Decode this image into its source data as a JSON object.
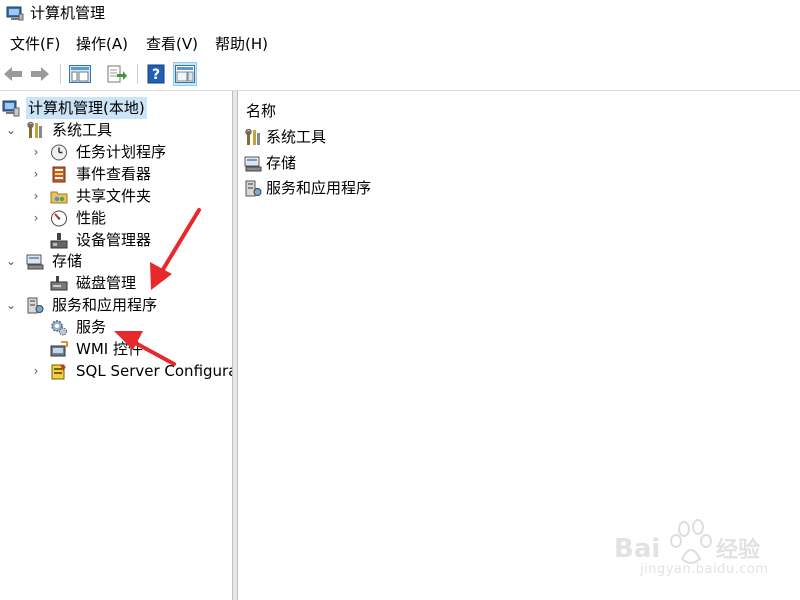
{
  "window": {
    "title": "计算机管理"
  },
  "menu": [
    {
      "label": "文件(F)"
    },
    {
      "label": "操作(A)"
    },
    {
      "label": "查看(V)"
    },
    {
      "label": "帮助(H)"
    }
  ],
  "toolbar": {
    "buttons": [
      {
        "name": "back-arrow-icon"
      },
      {
        "name": "forward-arrow-icon"
      },
      {
        "name": "show-console-tree-icon"
      },
      {
        "name": "export-list-icon"
      },
      {
        "name": "help-icon"
      },
      {
        "name": "show-action-pane-icon"
      }
    ]
  },
  "tree": {
    "root": {
      "label": "计算机管理(本地)",
      "icon": "computer-management-icon",
      "selected": true
    },
    "items": [
      {
        "label": "系统工具",
        "icon": "tools-icon",
        "level": 1,
        "expander": "expanded"
      },
      {
        "label": "任务计划程序",
        "icon": "clock-icon",
        "level": 2,
        "expander": "collapsed"
      },
      {
        "label": "事件查看器",
        "icon": "event-viewer-icon",
        "level": 2,
        "expander": "collapsed"
      },
      {
        "label": "共享文件夹",
        "icon": "shared-folder-icon",
        "level": 2,
        "expander": "collapsed"
      },
      {
        "label": "性能",
        "icon": "performance-icon",
        "level": 2,
        "expander": "collapsed"
      },
      {
        "label": "设备管理器",
        "icon": "device-manager-icon",
        "level": 2,
        "expander": "none"
      },
      {
        "label": "存储",
        "icon": "storage-icon",
        "level": 1,
        "expander": "expanded"
      },
      {
        "label": "磁盘管理",
        "icon": "disk-management-icon",
        "level": 2,
        "expander": "none"
      },
      {
        "label": "服务和应用程序",
        "icon": "services-apps-icon",
        "level": 1,
        "expander": "expanded"
      },
      {
        "label": "服务",
        "icon": "gear-icon",
        "level": 2,
        "expander": "none"
      },
      {
        "label": "WMI 控件",
        "icon": "wmi-control-icon",
        "level": 2,
        "expander": "none"
      },
      {
        "label": "SQL Server Configurati",
        "icon": "sql-server-icon",
        "level": 2,
        "expander": "collapsed"
      }
    ]
  },
  "list": {
    "header": "名称",
    "items": [
      {
        "label": "系统工具",
        "icon": "tools-icon"
      },
      {
        "label": "存储",
        "icon": "storage-icon"
      },
      {
        "label": "服务和应用程序",
        "icon": "services-apps-icon"
      }
    ]
  },
  "annotations": {
    "arrow_color": "#e8282b"
  },
  "watermark": {
    "text": "jingyan.baidu.com"
  }
}
